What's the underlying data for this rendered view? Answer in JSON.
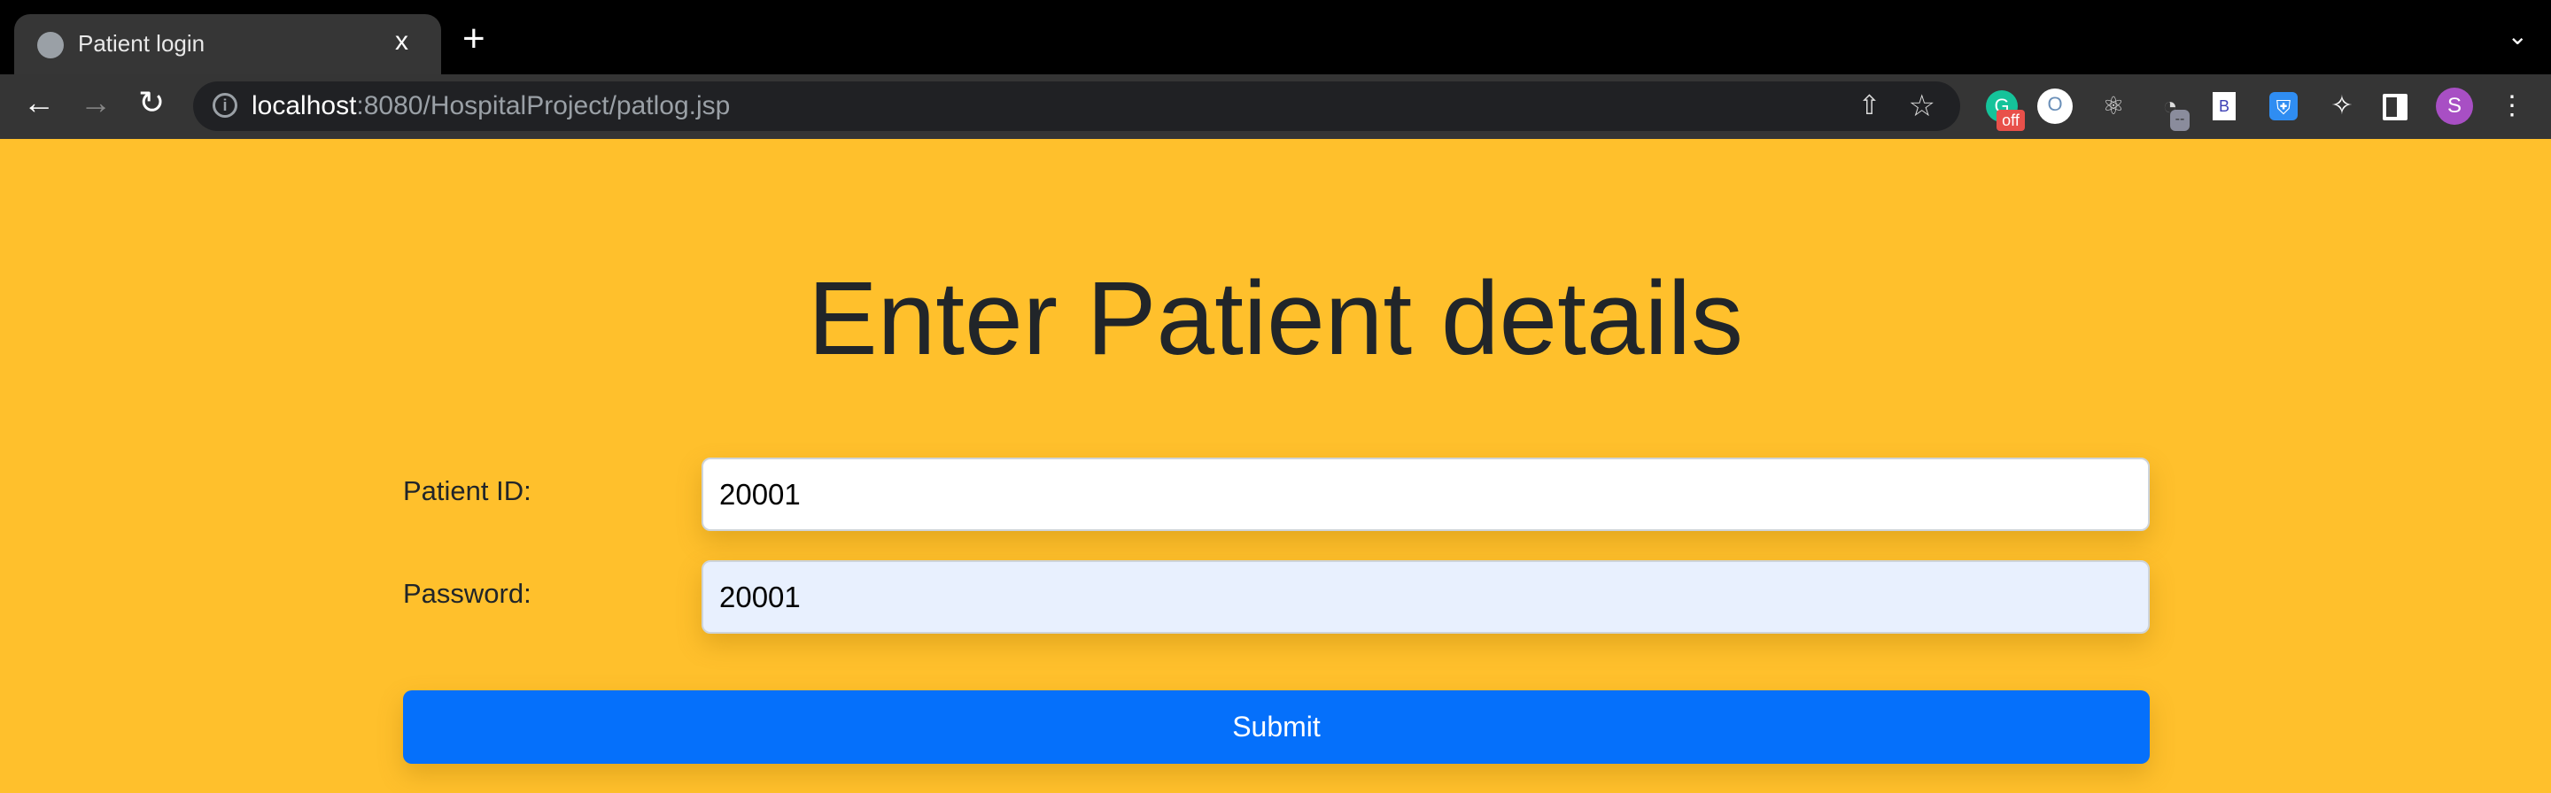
{
  "browser": {
    "tab_title": "Patient login",
    "close_tab": "x",
    "new_tab": "+",
    "url_host": "localhost",
    "url_rest": ":8080/HospitalProject/patlog.jsp",
    "extensions": [
      "grammarly-icon",
      "jsonview-icon",
      "react-devtools-icon",
      "speed-icon",
      "bootstrap-icon",
      "shield-icon",
      "puzzle-icon",
      "sidepanel-icon"
    ],
    "grammarly_badge": "off",
    "speed_badge": "--",
    "bootstrap_letter": "B",
    "profile_initial": "S",
    "profile_color": "#a84fc4"
  },
  "page": {
    "heading": "Enter Patient details",
    "patient_id_label": "Patient ID:",
    "patient_id_value": "20001",
    "password_label": "Password:",
    "password_value": "20001",
    "submit_label": "Submit",
    "background_color": "#ffc02c",
    "button_color": "#0570fb"
  }
}
